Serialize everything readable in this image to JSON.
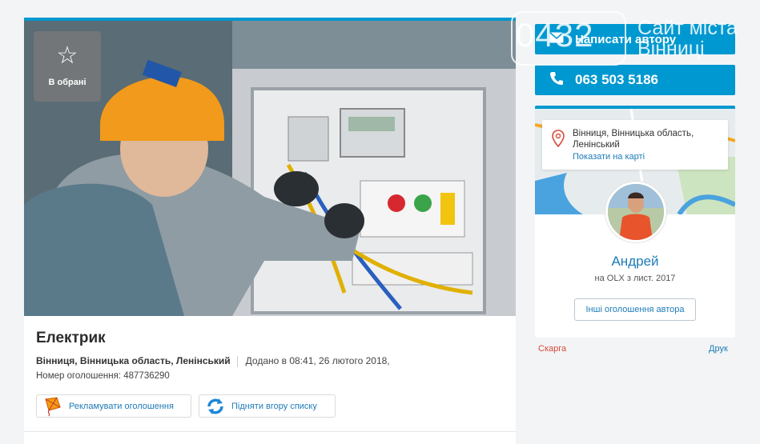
{
  "listing": {
    "favorite_label": "В обрані",
    "title": "Електрик",
    "location": "Вінниця, Вінницька область, Ленінський",
    "added": "Додано в 08:41, 26 лютого 2018,",
    "ad_number": "Номер оголошення: 487736290",
    "promote_label": "Рекламувати оголошення",
    "bump_label": "Підняти вгору списку"
  },
  "contact": {
    "write_label": "Написати автору",
    "phone": "063 503 5186"
  },
  "seller": {
    "location": "Вінниця, Вінницька область, Ленінський",
    "map_link": "Показати на карті",
    "name": "Андрей",
    "since": "на OLX з лист. 2017",
    "other_ads": "Інші оголошення автора"
  },
  "footer_links": {
    "complaint": "Скарга",
    "print": "Друк"
  },
  "watermark": {
    "code": "0432",
    "text_line1": "Сайт міста",
    "text_line2": "Вінниці"
  },
  "colors": {
    "accent": "#0098d0",
    "link": "#1e7bb8",
    "complaint": "#d94a3b"
  },
  "icons": [
    "star-icon",
    "envelope-icon",
    "phone-icon",
    "location-pin-icon",
    "kite-icon",
    "refresh-icon"
  ]
}
